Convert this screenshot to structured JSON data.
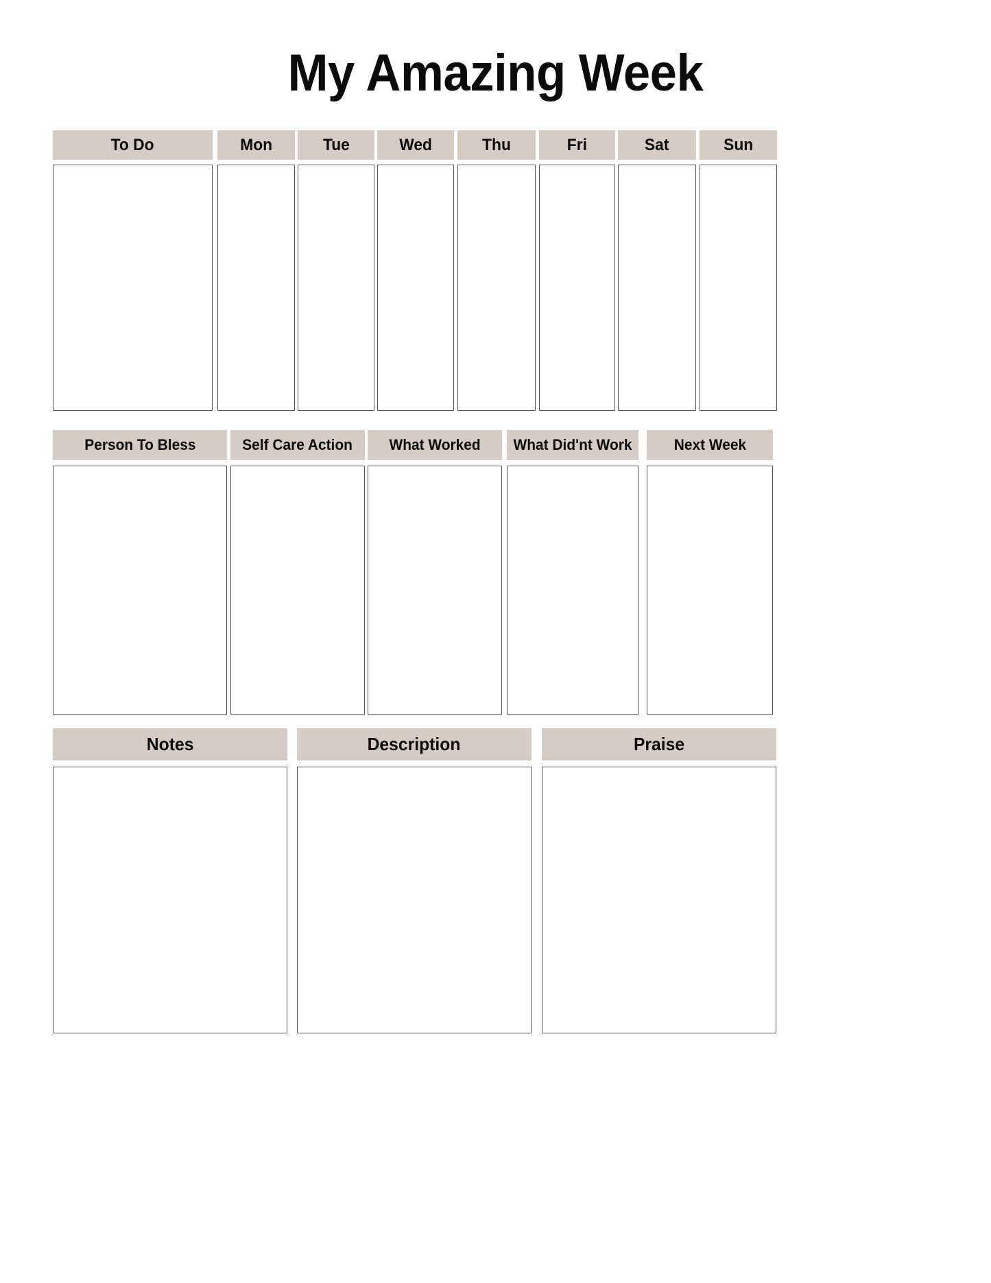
{
  "document": {
    "title": "My Amazing Week",
    "background_color": "#ffffff",
    "header_band_color": "#d5ccc5",
    "box_border_color": "#555555",
    "text_color": "#0b0b0b"
  },
  "sections": [
    {
      "id": "week",
      "name": "weekly-planner-row",
      "columns": [
        {
          "label": "To Do",
          "value": ""
        },
        {
          "label": "Mon",
          "value": ""
        },
        {
          "label": "Tue",
          "value": ""
        },
        {
          "label": "Wed",
          "value": ""
        },
        {
          "label": "Thu",
          "value": ""
        },
        {
          "label": "Fri",
          "value": ""
        },
        {
          "label": "Sat",
          "value": ""
        },
        {
          "label": "Sun",
          "value": ""
        }
      ]
    },
    {
      "id": "review",
      "name": "weekly-review-row",
      "columns": [
        {
          "label": "Person To Bless",
          "value": ""
        },
        {
          "label": "Self Care Action",
          "value": ""
        },
        {
          "label": "What Worked",
          "value": ""
        },
        {
          "label": "What Did'nt Work",
          "value": ""
        },
        {
          "label": "Next Week",
          "value": ""
        }
      ]
    },
    {
      "id": "notes",
      "name": "notes-row",
      "columns": [
        {
          "label": "Notes",
          "value": ""
        },
        {
          "label": "Description",
          "value": ""
        },
        {
          "label": "Praise",
          "value": ""
        }
      ]
    }
  ]
}
